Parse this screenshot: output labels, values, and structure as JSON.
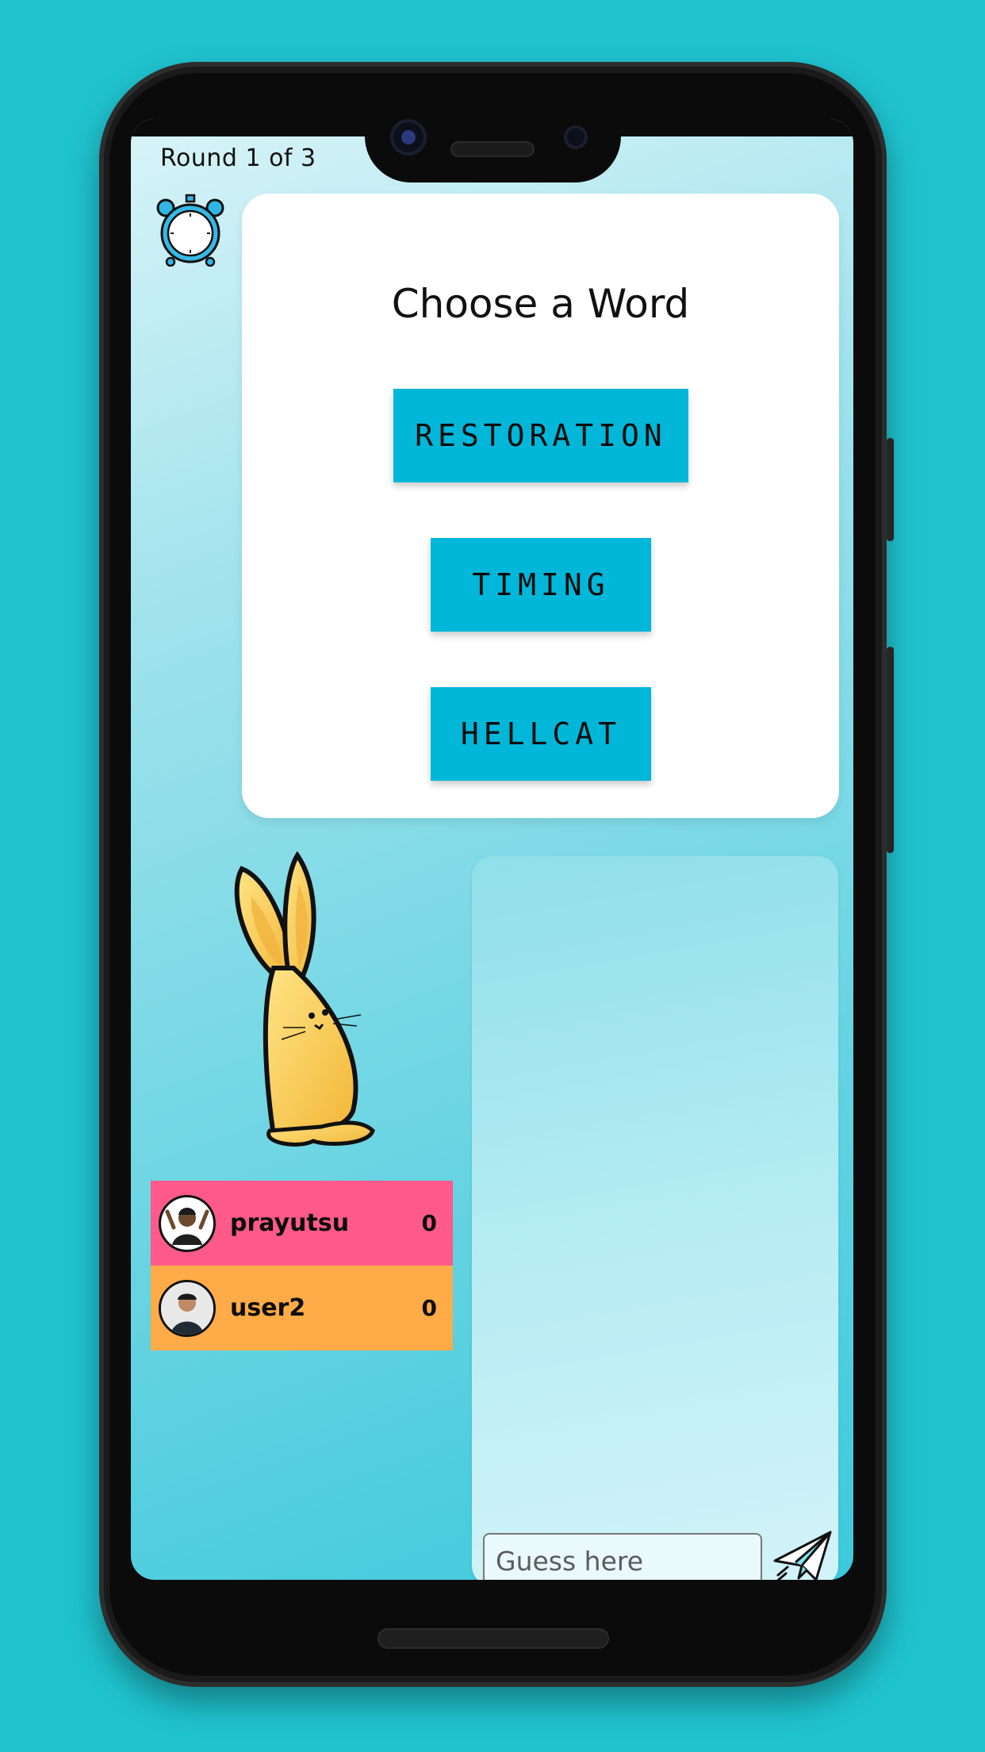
{
  "game": {
    "round_text": "Round 1 of 3"
  },
  "word_chooser": {
    "title": "Choose a Word",
    "words": [
      "RESTORATION",
      "TIMING",
      "HELLCAT"
    ]
  },
  "players": [
    {
      "name": "prayutsu",
      "score": "0",
      "color": "#ff5a8a"
    },
    {
      "name": "user2",
      "score": "0",
      "color": "#ffab47"
    }
  ],
  "chat": {
    "input_placeholder": "Guess here"
  },
  "icons": {
    "timer": "alarm-clock-icon",
    "send": "paper-plane-icon",
    "mascot": "yellow-rabbit-illustration"
  },
  "colors": {
    "background": "#1fc3cf",
    "word_button": "#00b7d9",
    "player1_row": "#ff5a8a",
    "player2_row": "#ffab47"
  }
}
